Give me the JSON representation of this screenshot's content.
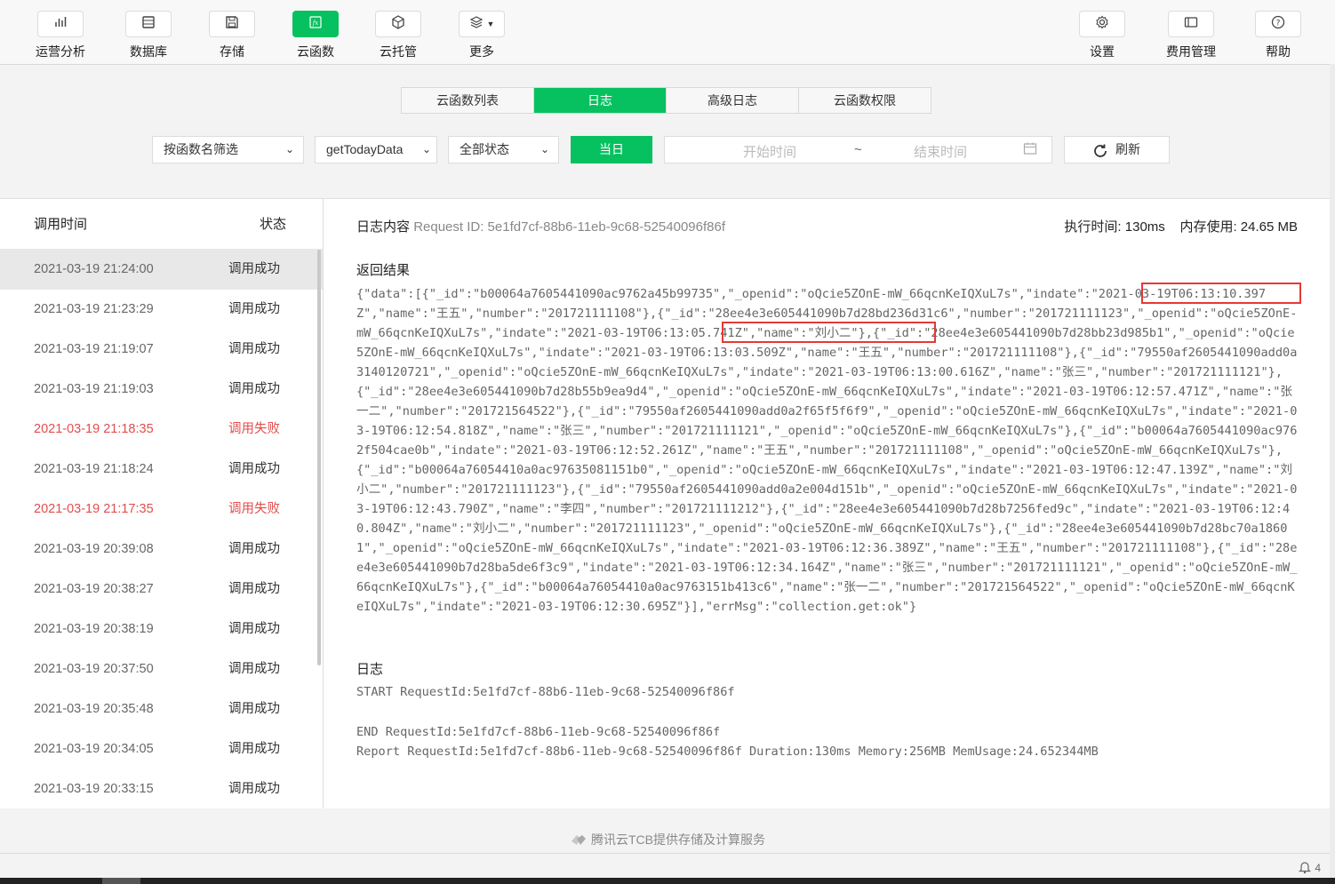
{
  "toolbar": {
    "left": [
      {
        "label": "运营分析",
        "icon": "bar-chart-icon"
      },
      {
        "label": "数据库",
        "icon": "database-icon"
      },
      {
        "label": "存储",
        "icon": "storage-icon"
      },
      {
        "label": "云函数",
        "icon": "function-icon",
        "active": true
      },
      {
        "label": "云托管",
        "icon": "cube-icon"
      },
      {
        "label": "更多",
        "icon": "layers-icon"
      }
    ],
    "right": [
      {
        "label": "设置",
        "icon": "gear-icon"
      },
      {
        "label": "费用管理",
        "icon": "billing-icon"
      },
      {
        "label": "帮助",
        "icon": "help-icon"
      }
    ]
  },
  "tabs": [
    "云函数列表",
    "日志",
    "高级日志",
    "云函数权限"
  ],
  "active_tab": "日志",
  "filters": {
    "function_filter": "按函数名筛选",
    "function_name": "getTodayData",
    "status": "全部状态",
    "today_button": "当日",
    "start_placeholder": "开始时间",
    "range_sep": "~",
    "end_placeholder": "结束时间",
    "refresh": "刷新"
  },
  "list": {
    "header_time": "调用时间",
    "header_status": "状态",
    "rows": [
      {
        "time": "2021-03-19 21:24:00",
        "status": "调用成功",
        "selected": true
      },
      {
        "time": "2021-03-19 21:23:29",
        "status": "调用成功"
      },
      {
        "time": "2021-03-19 21:19:07",
        "status": "调用成功"
      },
      {
        "time": "2021-03-19 21:19:03",
        "status": "调用成功"
      },
      {
        "time": "2021-03-19 21:18:35",
        "status": "调用失败",
        "fail": true
      },
      {
        "time": "2021-03-19 21:18:24",
        "status": "调用成功"
      },
      {
        "time": "2021-03-19 21:17:35",
        "status": "调用失败",
        "fail": true
      },
      {
        "time": "2021-03-19 20:39:08",
        "status": "调用成功"
      },
      {
        "time": "2021-03-19 20:38:27",
        "status": "调用成功"
      },
      {
        "time": "2021-03-19 20:38:19",
        "status": "调用成功"
      },
      {
        "time": "2021-03-19 20:37:50",
        "status": "调用成功"
      },
      {
        "time": "2021-03-19 20:35:48",
        "status": "调用成功"
      },
      {
        "time": "2021-03-19 20:34:05",
        "status": "调用成功"
      },
      {
        "time": "2021-03-19 20:33:15",
        "status": "调用成功"
      }
    ]
  },
  "detail": {
    "title": "日志内容",
    "request_id": "Request ID: 5e1fd7cf-88b6-11eb-9c68-52540096f86f",
    "exec_time": "执行时间: 130ms",
    "memory": "内存使用: 24.65 MB",
    "result_label": "返回结果",
    "result_json": "{\"data\":[{\"_id\":\"b00064a7605441090ac9762a45b99735\",\"_openid\":\"oQcie5ZOnE-mW_66qcnKeIQXuL7s\",\"indate\":\"2021-03-19T06:13:10.397Z\",\"name\":\"王五\",\"number\":\"201721111108\"},{\"_id\":\"28ee4e3e605441090b7d28bd236d31c6\",\"number\":\"201721111123\",\"_openid\":\"oQcie5ZOnE-mW_66qcnKeIQXuL7s\",\"indate\":\"2021-03-19T06:13:05.741Z\",\"name\":\"刘小二\"},{\"_id\":\"28ee4e3e605441090b7d28bb23d985b1\",\"_openid\":\"oQcie5ZOnE-mW_66qcnKeIQXuL7s\",\"indate\":\"2021-03-19T06:13:03.509Z\",\"name\":\"王五\",\"number\":\"201721111108\"},{\"_id\":\"79550af2605441090add0a3140120721\",\"_openid\":\"oQcie5ZOnE-mW_66qcnKeIQXuL7s\",\"indate\":\"2021-03-19T06:13:00.616Z\",\"name\":\"张三\",\"number\":\"201721111121\"},{\"_id\":\"28ee4e3e605441090b7d28b55b9ea9d4\",\"_openid\":\"oQcie5ZOnE-mW_66qcnKeIQXuL7s\",\"indate\":\"2021-03-19T06:12:57.471Z\",\"name\":\"张一二\",\"number\":\"201721564522\"},{\"_id\":\"79550af2605441090add0a2f65f5f6f9\",\"_openid\":\"oQcie5ZOnE-mW_66qcnKeIQXuL7s\",\"indate\":\"2021-03-19T06:12:54.818Z\",\"name\":\"张三\",\"number\":\"201721111121\",\"_openid\":\"oQcie5ZOnE-mW_66qcnKeIQXuL7s\"},{\"_id\":\"b00064a7605441090ac9762f504cae0b\",\"indate\":\"2021-03-19T06:12:52.261Z\",\"name\":\"王五\",\"number\":\"201721111108\",\"_openid\":\"oQcie5ZOnE-mW_66qcnKeIQXuL7s\"},{\"_id\":\"b00064a76054410a0ac97635081151b0\",\"_openid\":\"oQcie5ZOnE-mW_66qcnKeIQXuL7s\",\"indate\":\"2021-03-19T06:12:47.139Z\",\"name\":\"刘小二\",\"number\":\"201721111123\"},{\"_id\":\"79550af2605441090add0a2e004d151b\",\"_openid\":\"oQcie5ZOnE-mW_66qcnKeIQXuL7s\",\"indate\":\"2021-03-19T06:12:43.790Z\",\"name\":\"李四\",\"number\":\"201721111212\"},{\"_id\":\"28ee4e3e605441090b7d28b7256fed9c\",\"indate\":\"2021-03-19T06:12:40.804Z\",\"name\":\"刘小二\",\"number\":\"201721111123\",\"_openid\":\"oQcie5ZOnE-mW_66qcnKeIQXuL7s\"},{\"_id\":\"28ee4e3e605441090b7d28bc70a18601\",\"_openid\":\"oQcie5ZOnE-mW_66qcnKeIQXuL7s\",\"indate\":\"2021-03-19T06:12:36.389Z\",\"name\":\"王五\",\"number\":\"201721111108\"},{\"_id\":\"28ee4e3e605441090b7d28ba5de6f3c9\",\"indate\":\"2021-03-19T06:12:34.164Z\",\"name\":\"张三\",\"number\":\"201721111121\",\"_openid\":\"oQcie5ZOnE-mW_66qcnKeIQXuL7s\"},{\"_id\":\"b00064a76054410a0ac9763151b413c6\",\"name\":\"张一二\",\"number\":\"201721564522\",\"_openid\":\"oQcie5ZOnE-mW_66qcnKeIQXuL7s\",\"indate\":\"2021-03-19T06:12:30.695Z\"}],\"errMsg\":\"collection.get:ok\"}",
    "log_label": "日志",
    "log_start": "START RequestId:5e1fd7cf-88b6-11eb-9c68-52540096f86f",
    "log_end": "END RequestId:5e1fd7cf-88b6-11eb-9c68-52540096f86f",
    "log_report": "Report RequestId:5e1fd7cf-88b6-11eb-9c68-52540096f86f Duration:130ms Memory:256MB MemUsage:24.652344MB"
  },
  "footer": {
    "text": "腾讯云TCB提供存储及计算服务"
  },
  "notification_count": "4",
  "colors": {
    "accent": "#07c160",
    "fail": "#e34d4d",
    "highlight": "#e53935"
  }
}
